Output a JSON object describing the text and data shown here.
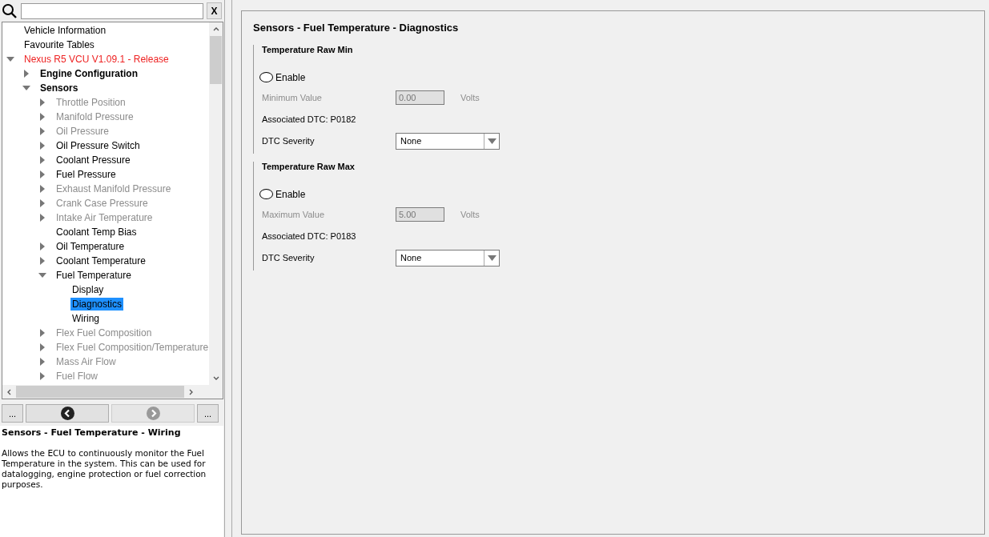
{
  "search": {
    "clear_label": "X"
  },
  "tree": [
    {
      "label": "Vehicle Information",
      "disabled": false,
      "selected": false
    },
    {
      "label": "Favourite Tables",
      "disabled": false,
      "selected": false
    },
    {
      "label": "Nexus R5 VCU V1.09.1 - Release",
      "kind": "root",
      "disabled": false,
      "selected": false,
      "expanded": true,
      "children": [
        {
          "label": "Engine Configuration",
          "kind": "group",
          "disabled": false,
          "selected": false,
          "expanded": false
        },
        {
          "label": "Sensors",
          "kind": "group",
          "disabled": false,
          "selected": false,
          "expanded": true,
          "children": [
            {
              "label": "Throttle Position",
              "disabled": true,
              "selected": false,
              "expanded": false
            },
            {
              "label": "Manifold Pressure",
              "disabled": true,
              "selected": false,
              "expanded": false
            },
            {
              "label": "Oil Pressure",
              "disabled": true,
              "selected": false,
              "expanded": false
            },
            {
              "label": "Oil Pressure Switch",
              "disabled": false,
              "selected": false,
              "expanded": false
            },
            {
              "label": "Coolant Pressure",
              "disabled": false,
              "selected": false,
              "expanded": false
            },
            {
              "label": "Fuel Pressure",
              "disabled": false,
              "selected": false,
              "expanded": false
            },
            {
              "label": "Exhaust Manifold Pressure",
              "disabled": true,
              "selected": false,
              "expanded": false
            },
            {
              "label": "Crank Case Pressure",
              "disabled": true,
              "selected": false,
              "expanded": false
            },
            {
              "label": "Intake Air Temperature",
              "disabled": true,
              "selected": false,
              "expanded": false
            },
            {
              "label": "Coolant Temp Bias",
              "disabled": false,
              "selected": false
            },
            {
              "label": "Oil Temperature",
              "disabled": false,
              "selected": false,
              "expanded": false
            },
            {
              "label": "Coolant Temperature",
              "disabled": false,
              "selected": false,
              "expanded": false
            },
            {
              "label": "Fuel Temperature",
              "disabled": false,
              "selected": false,
              "expanded": true,
              "children": [
                {
                  "label": "Display",
                  "disabled": false,
                  "selected": false
                },
                {
                  "label": "Diagnostics",
                  "disabled": false,
                  "selected": true
                },
                {
                  "label": "Wiring",
                  "disabled": false,
                  "selected": false
                }
              ]
            },
            {
              "label": "Flex Fuel Composition",
              "disabled": true,
              "selected": false,
              "expanded": false
            },
            {
              "label": "Flex Fuel Composition/Temperature",
              "disabled": true,
              "selected": false,
              "expanded": false
            },
            {
              "label": "Mass Air Flow",
              "disabled": true,
              "selected": false,
              "expanded": false
            },
            {
              "label": "Fuel Flow",
              "disabled": true,
              "selected": false,
              "expanded": false
            }
          ]
        }
      ]
    }
  ],
  "nav": {
    "left_more": "...",
    "right_more": "...",
    "back_disabled": false,
    "forward_disabled": true
  },
  "help": {
    "title": "Sensors - Fuel Temperature - Wiring",
    "text": "Allows the ECU to continuously monitor the Fuel Temperature in the system. This can be used for datalogging, engine protection or fuel correction purposes."
  },
  "page": {
    "title": "Sensors - Fuel Temperature - Diagnostics",
    "sections": [
      {
        "title": "Temperature Raw Min",
        "enable": {
          "label": "Enable",
          "checked": false
        },
        "value_label": "Minimum Value",
        "value": "0.00",
        "unit": "Volts",
        "disabled": true,
        "dtc": "Associated DTC: P0182",
        "severity_label": "DTC Severity",
        "severity": "None"
      },
      {
        "title": "Temperature Raw Max",
        "enable": {
          "label": "Enable",
          "checked": false
        },
        "value_label": "Maximum Value",
        "value": "5.00",
        "unit": "Volts",
        "disabled": true,
        "dtc": "Associated DTC: P0183",
        "severity_label": "DTC Severity",
        "severity": "None"
      }
    ]
  }
}
